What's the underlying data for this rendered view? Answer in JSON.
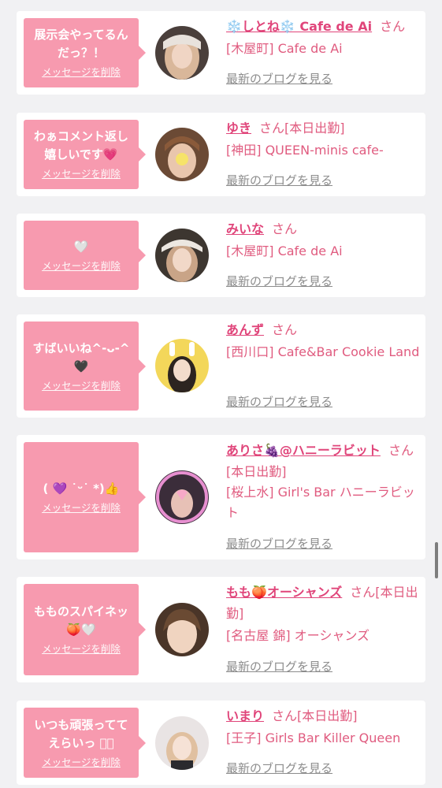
{
  "delete_label": "メッセージを削除",
  "blog_label": "最新のブログを見る",
  "colors": {
    "accent": "#f79aaf",
    "name": "#e0457a",
    "text": "#e05b7f",
    "background": "#f1f1f3"
  },
  "cards": [
    {
      "message": "展示会やってるん\nだっ？！",
      "name": "❄️しとね❄️ Cafe de Ai",
      "san": "さん",
      "shop": "[木屋町] Cafe de Ai"
    },
    {
      "message": "わぁコメント返し\n嬉しいです💗",
      "name": "ゆき",
      "san": "さん[本日出勤]",
      "shop": "[神田] QUEEN-minis cafe-"
    },
    {
      "message": "🤍",
      "name": "みいな",
      "san": "さん",
      "shop": "[木屋町] Cafe de Ai"
    },
    {
      "message": "すばいいね^-ᴗ-^\n🖤",
      "name": "あんず",
      "san": "さん",
      "shop": "[西川口] Cafe&Bar Cookie Land"
    },
    {
      "message": "( 💜 ˙ᵕ˙ *)👍",
      "name": "ありさ🍇@ハニーラビット",
      "san": "さん[本日出勤]",
      "shop": "[桜上水] Girl's Bar ハニーラビット"
    },
    {
      "message": "もものスパイネッ\n🍑🤍",
      "name": "もも🍑オーシャンズ",
      "san": "さん[本日出勤]",
      "shop": "[名古屋 錦] オーシャンズ"
    },
    {
      "message": "いつも頑張ってて\nえらいっ ꩜᪲",
      "name": "いまり",
      "san": "さん[本日出勤]",
      "shop": "[王子] Girls Bar Killer Queen"
    }
  ]
}
